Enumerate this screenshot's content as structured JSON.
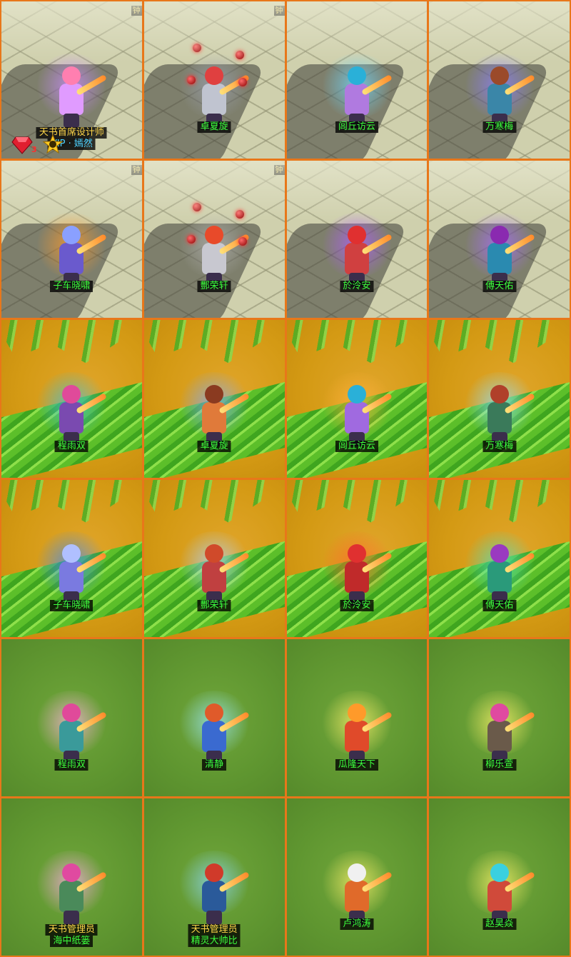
{
  "cells": [
    {
      "bg": "tile",
      "line1": "天书首席设计师",
      "line1_style": "gold",
      "line2": "VIP · 嫣然",
      "line2_style": "vip",
      "corner": "钟",
      "badge": true,
      "badge_count": "3",
      "aura": "#c98bff",
      "head": "#ff7fb0",
      "body": "#e09bff"
    },
    {
      "bg": "tile",
      "line1": "卓夏旋",
      "corner": "钟",
      "orbs": true,
      "aura": "#9aa0b0",
      "head": "#e04040",
      "body": "#c0c4d0"
    },
    {
      "bg": "tile",
      "line1": "闾丘访云",
      "corner": "",
      "aura": "#6fd8ff",
      "head": "#2ab0d8",
      "body": "#b07ae0"
    },
    {
      "bg": "tile",
      "line1": "万寒梅",
      "corner": "",
      "aura": "#8a7dff",
      "head": "#9b4a2a",
      "body": "#3a86a8"
    },
    {
      "bg": "tile",
      "line1": "子车晓啸",
      "corner": "钟",
      "aura": "#ff9a2a",
      "head": "#8aa0ff",
      "body": "#6a5acd"
    },
    {
      "bg": "tile",
      "line1": "酆荣轩",
      "corner": "钟",
      "orbs": true,
      "aura": "#b0b0b0",
      "head": "#e84a2a",
      "body": "#c8c8d0"
    },
    {
      "bg": "tile",
      "line1": "於泠安",
      "corner": "",
      "aura": "#b15cff",
      "head": "#e03030",
      "body": "#d04040"
    },
    {
      "bg": "tile",
      "line1": "傅天佑",
      "corner": "",
      "aura": "#a86bff",
      "head": "#8a2ab0",
      "body": "#2a8ab0"
    },
    {
      "bg": "sand",
      "line1": "程雨双",
      "aura": "#3ac0e0",
      "head": "#e04a9a",
      "body": "#7a4ab0"
    },
    {
      "bg": "sand",
      "line1": "卓夏旋",
      "aura": "#7aa8ff",
      "head": "#8a3a20",
      "body": "#e07a3a"
    },
    {
      "bg": "sand",
      "line1": "闾丘访云",
      "aura": "#ffb03a",
      "head": "#2ab0d8",
      "body": "#a06ae0"
    },
    {
      "bg": "sand",
      "line1": "万寒梅",
      "aura": "#8adfff",
      "head": "#b0402a",
      "body": "#3a7a5a"
    },
    {
      "bg": "sand",
      "line1": "子车晓啸",
      "aura": "#3a8aff",
      "head": "#b0c0ff",
      "body": "#7a7ae0"
    },
    {
      "bg": "sand",
      "line1": "酆荣轩",
      "aura": "#a8d0ff",
      "head": "#d04a2a",
      "body": "#c04040"
    },
    {
      "bg": "sand",
      "line1": "於泠安",
      "aura": "#ff6a2a",
      "head": "#e03030",
      "body": "#c02a2a"
    },
    {
      "bg": "sand",
      "line1": "傅天佑",
      "aura": "#4ae0c0",
      "head": "#9a3ac0",
      "body": "#2a9a7a"
    },
    {
      "bg": "grass",
      "line1": "程雨双",
      "aura": "#ffb0e0",
      "head": "#e04a9a",
      "body": "#3a9a9a"
    },
    {
      "bg": "grass",
      "line1": "清静",
      "aura": "#9ae8ff",
      "head": "#e05a2a",
      "body": "#3a6ad0"
    },
    {
      "bg": "grass",
      "line1": "瓜隆天下",
      "aura": "#fff06a",
      "head": "#ff9a2a",
      "body": "#e04a2a"
    },
    {
      "bg": "grass",
      "line1": "柳乐萱",
      "aura": "#fff26a",
      "head": "#e04aa0",
      "body": "#6a5a4a"
    },
    {
      "bg": "grass",
      "line1": "天书管理员",
      "line1_style": "gold",
      "line2": "海中纸篓",
      "aura": "#ffa8e8",
      "head": "#e04aa0",
      "body": "#4a8a5a"
    },
    {
      "bg": "grass",
      "line1": "天书管理员",
      "line1_style": "gold",
      "line2": "精灵大帅比",
      "aura": "#8ad8ff",
      "head": "#d03a2a",
      "body": "#2a5a9a"
    },
    {
      "bg": "grass",
      "line1": "卢鸿涛",
      "aura": "#fff06a",
      "head": "#f0f0f0",
      "body": "#e06a2a"
    },
    {
      "bg": "grass",
      "line1": "赵昊焱",
      "aura": "#fff26a",
      "head": "#3ad0e0",
      "body": "#d04a3a"
    }
  ]
}
